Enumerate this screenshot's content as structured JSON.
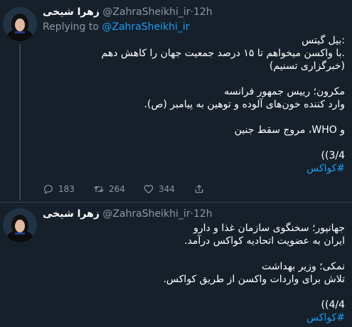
{
  "colors": {
    "background": "#15202b",
    "text_primary": "#ffffff",
    "text_secondary": "#8b98a5",
    "link": "#1d9bf0",
    "divider": "#38444d"
  },
  "tweets": [
    {
      "display_name": "زهرا شیخی",
      "handle": "@ZahraSheikhi_ir",
      "separator": "·",
      "time": "12h",
      "reply_prefix": "Replying to ",
      "reply_to": "@ZahraSheikhi_ir",
      "lines": [
        ":بیل گیتس",
        ".با واکسن میخواهم تا ۱۵ درصد جمعیت جهان را کاهش دهم",
        "(خبرگزاری تسنیم)",
        "",
        "مکرون؛ رییس جمهور فرانسه",
        "وارد کننده خون‌های آلوده و توهین به پیامبر (ص).",
        "",
        "و WHO، مروج سقط جنین",
        "",
        "3/4))"
      ],
      "hashtag": "#کواکس",
      "stats": {
        "replies": "183",
        "retweets": "264",
        "likes": "344"
      }
    },
    {
      "display_name": "زهرا شیخی",
      "handle": "@ZahraSheikhi_ir",
      "separator": "·",
      "time": "12h",
      "lines": [
        "جهانپور؛ سخنگوی سازمان غذا و دارو",
        "ایران به عضویت اتحادیه کواکس درآمد.",
        "",
        "نمکی؛ وزیر بهداشت",
        "تلاش برای واردات واکسن از طریق کواکس.",
        "",
        "4/4))"
      ],
      "hashtag": "#کواکس"
    }
  ]
}
